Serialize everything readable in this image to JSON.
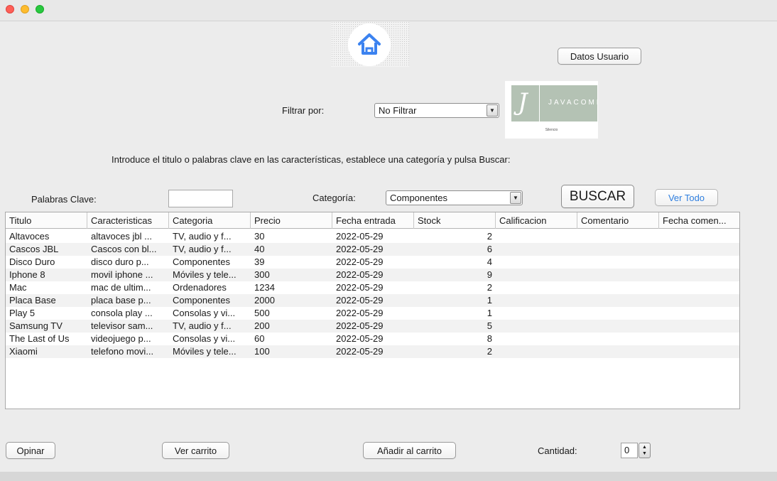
{
  "window": {
    "traffic_lights": [
      "close",
      "minimize",
      "maximize"
    ]
  },
  "header": {
    "home_icon": "home-icon",
    "user_button": "Datos Usuario"
  },
  "filter": {
    "label": "Filtrar por:",
    "selected": "No Filtrar"
  },
  "logo": {
    "wordmark": "JAVACOMP",
    "tagline": "Silencio"
  },
  "instructions": "Introduce el titulo o palabras clave en las características, establece una categoría y pulsa Buscar:",
  "search": {
    "keywords_label": "Palabras Clave:",
    "keywords_value": "",
    "category_label": "Categoría:",
    "category_selected": "Componentes",
    "search_button": "BUSCAR",
    "view_all_button": "Ver Todo"
  },
  "table": {
    "columns": [
      "Titulo",
      "Caracteristicas",
      "Categoria",
      "Precio",
      "Fecha entrada",
      "Stock",
      "Calificacion",
      "Comentario",
      "Fecha comen..."
    ],
    "rows": [
      [
        "Altavoces",
        "altavoces jbl ...",
        "TV, audio y f...",
        "30",
        "2022-05-29",
        "2",
        "",
        "",
        ""
      ],
      [
        "Cascos JBL",
        "Cascos con bl...",
        "TV, audio y f...",
        "40",
        "2022-05-29",
        "6",
        "",
        "",
        ""
      ],
      [
        "Disco Duro",
        "disco duro p...",
        "Componentes",
        "39",
        "2022-05-29",
        "4",
        "",
        "",
        ""
      ],
      [
        "Iphone 8",
        "movil iphone ...",
        "Móviles y tele...",
        "300",
        "2022-05-29",
        "9",
        "",
        "",
        ""
      ],
      [
        "Mac",
        "mac de ultim...",
        "Ordenadores",
        "1234",
        "2022-05-29",
        "2",
        "",
        "",
        ""
      ],
      [
        "Placa Base",
        "placa base p...",
        "Componentes",
        "2000",
        "2022-05-29",
        "1",
        "",
        "",
        ""
      ],
      [
        "Play 5",
        "consola play ...",
        "Consolas y vi...",
        "500",
        "2022-05-29",
        "1",
        "",
        "",
        ""
      ],
      [
        "Samsung TV",
        "televisor sam...",
        "TV, audio y f...",
        "200",
        "2022-05-29",
        "5",
        "",
        "",
        ""
      ],
      [
        "The Last of Us",
        "videojuego p...",
        "Consolas y vi...",
        "60",
        "2022-05-29",
        "8",
        "",
        "",
        ""
      ],
      [
        "Xiaomi",
        "telefono movi...",
        "Móviles y tele...",
        "100",
        "2022-05-29",
        "2",
        "",
        "",
        ""
      ]
    ]
  },
  "footer": {
    "review_button": "Opinar",
    "cart_button": "Ver carrito",
    "add_button": "Añadir al carrito",
    "quantity_label": "Cantidad:",
    "quantity_value": "0"
  }
}
